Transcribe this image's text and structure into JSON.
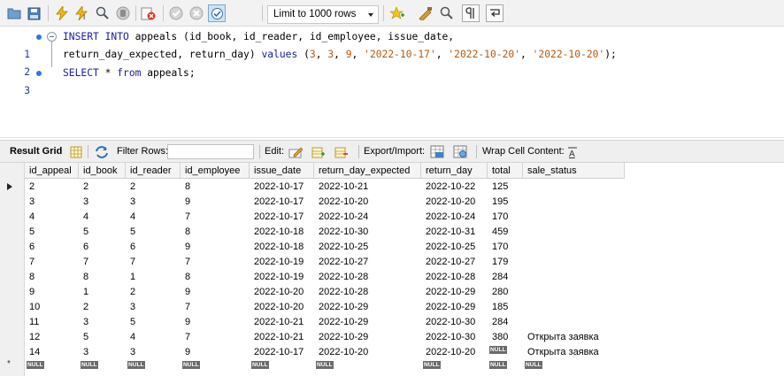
{
  "toolbar": {
    "limit_value": "Limit to 1000 rows",
    "icons": [
      "open-folder-icon",
      "save-icon",
      "execute-icon",
      "execute-current-icon",
      "explain-icon",
      "stop-icon",
      "toggle-error-icon",
      "commit-icon",
      "rollback-icon",
      "autocommit-icon",
      "add-snippet-icon",
      "beautify-icon",
      "find-icon",
      "invisible-chars-icon",
      "wrap-lines-icon"
    ]
  },
  "editor": {
    "lines": [
      {
        "num": "1",
        "tokens": [
          {
            "t": "INSERT INTO",
            "c": "kw"
          },
          {
            "t": " appeals (id_book, id_reader, id_employee, issue_date,",
            "c": ""
          }
        ]
      },
      {
        "num": "2",
        "tokens": [
          {
            "t": "return_day_expected, return_day) ",
            "c": ""
          },
          {
            "t": "values",
            "c": "kw"
          },
          {
            "t": " (",
            "c": ""
          },
          {
            "t": "3",
            "c": "num"
          },
          {
            "t": ", ",
            "c": ""
          },
          {
            "t": "3",
            "c": "num"
          },
          {
            "t": ", ",
            "c": ""
          },
          {
            "t": "9",
            "c": "num"
          },
          {
            "t": ", ",
            "c": ""
          },
          {
            "t": "'2022-10-17'",
            "c": "str"
          },
          {
            "t": ", ",
            "c": ""
          },
          {
            "t": "'2022-10-20'",
            "c": "str"
          },
          {
            "t": ", ",
            "c": ""
          },
          {
            "t": "'2022-10-20'",
            "c": "str"
          },
          {
            "t": ");",
            "c": ""
          }
        ]
      },
      {
        "num": "3",
        "tokens": [
          {
            "t": "SELECT",
            "c": "kw"
          },
          {
            "t": " * ",
            "c": ""
          },
          {
            "t": "from",
            "c": "kw"
          },
          {
            "t": " appeals;",
            "c": ""
          }
        ]
      }
    ]
  },
  "result_toolbar": {
    "result_grid": "Result Grid",
    "filter_rows": "Filter Rows:",
    "edit": "Edit:",
    "export_import": "Export/Import:",
    "wrap_cell": "Wrap Cell Content:"
  },
  "grid": {
    "columns": [
      "id_appeal",
      "id_book",
      "id_reader",
      "id_employee",
      "issue_date",
      "return_day_expected",
      "return_day",
      "total",
      "sale_status"
    ],
    "rows": [
      [
        "2",
        "2",
        "2",
        "8",
        "2022-10-17",
        "2022-10-21",
        "2022-10-22",
        "125",
        ""
      ],
      [
        "3",
        "3",
        "3",
        "9",
        "2022-10-17",
        "2022-10-20",
        "2022-10-20",
        "195",
        ""
      ],
      [
        "4",
        "4",
        "4",
        "7",
        "2022-10-17",
        "2022-10-24",
        "2022-10-24",
        "170",
        ""
      ],
      [
        "5",
        "5",
        "5",
        "8",
        "2022-10-18",
        "2022-10-30",
        "2022-10-31",
        "459",
        ""
      ],
      [
        "6",
        "6",
        "6",
        "9",
        "2022-10-18",
        "2022-10-25",
        "2022-10-25",
        "170",
        ""
      ],
      [
        "7",
        "7",
        "7",
        "7",
        "2022-10-19",
        "2022-10-27",
        "2022-10-27",
        "179",
        ""
      ],
      [
        "8",
        "8",
        "1",
        "8",
        "2022-10-19",
        "2022-10-28",
        "2022-10-28",
        "284",
        ""
      ],
      [
        "9",
        "1",
        "2",
        "9",
        "2022-10-20",
        "2022-10-28",
        "2022-10-29",
        "280",
        ""
      ],
      [
        "10",
        "2",
        "3",
        "7",
        "2022-10-20",
        "2022-10-29",
        "2022-10-29",
        "185",
        ""
      ],
      [
        "11",
        "3",
        "5",
        "9",
        "2022-10-21",
        "2022-10-29",
        "2022-10-30",
        "284",
        ""
      ],
      [
        "12",
        "5",
        "4",
        "7",
        "2022-10-21",
        "2022-10-29",
        "2022-10-30",
        "380",
        "Открыта заявка"
      ],
      [
        "14",
        "3",
        "3",
        "9",
        "2022-10-17",
        "2022-10-20",
        "2022-10-20",
        "NULL",
        "Открыта заявка"
      ]
    ],
    "null_label": "NULL",
    "new_row_marker": "*"
  }
}
